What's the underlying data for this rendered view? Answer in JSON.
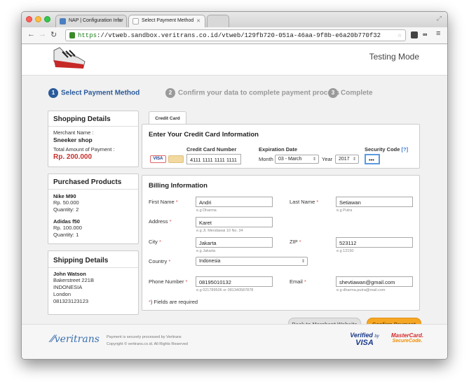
{
  "browser": {
    "tabs": [
      {
        "label": "NAP | Configuration Infor"
      },
      {
        "label": "Select Payment Method"
      }
    ],
    "url_scheme": "https",
    "url_rest": "://vtweb.sandbox.veritrans.co.id/vtweb/129fb720-051a-46aa-9f8b-e6a20b770f32"
  },
  "header": {
    "mode": "Testing Mode"
  },
  "steps": [
    {
      "num": "1",
      "label": "Select Payment Method",
      "active": true
    },
    {
      "num": "2",
      "label": "Confirm your data to complete payment process",
      "active": false
    },
    {
      "num": "3",
      "label": "Complete",
      "active": false
    }
  ],
  "shopping": {
    "title": "Shopping Details",
    "merchant_label": "Merchant Name :",
    "merchant": "Sneeker shop",
    "total_label": "Total Amount of Payment :",
    "total": "Rp. 200.000"
  },
  "products": {
    "title": "Purchased Products",
    "items": [
      {
        "name": "Nike M90",
        "price": "Rp. 50.000",
        "qty": "Quantity: 2"
      },
      {
        "name": "Adidas f50",
        "price": "Rp. 100.000",
        "qty": "Quantity: 1"
      }
    ]
  },
  "shipping": {
    "title": "Shipping Details",
    "name": "John Watson",
    "line1": "Bakerstreet 221B",
    "line2": "INDONESIA",
    "line3": "London",
    "phone": "081323123123"
  },
  "card": {
    "tab": "Credit Card",
    "heading": "Enter Your Credit Card Information",
    "number_label": "Credit Card Number",
    "number": "4111 1111 1111 1111",
    "expiry_label": "Expiration Date",
    "month_label": "Month",
    "month": "03 - March",
    "year_label": "Year",
    "year": "2017",
    "cvv_label": "Security Code",
    "cvv_help": "[?]",
    "cvv": "•••",
    "visa": "VISA"
  },
  "billing": {
    "heading": "Billing Information",
    "first_name_label": "First Name",
    "first_name": "Andri",
    "first_name_hint": "e.g Dharma",
    "last_name_label": "Last Name",
    "last_name": "Setiawan",
    "last_name_hint": "e.g Putra",
    "address_label": "Address",
    "address": "Karet",
    "address_hint": "e.g Jl. Mendawai 10 No. 34",
    "city_label": "City",
    "city": "Jakarta",
    "city_hint": "e.g Jakarta",
    "zip_label": "ZIP",
    "zip": "523112",
    "zip_hint": "e.g 12150",
    "country_label": "Country",
    "country": "Indonesia",
    "phone_label": "Phone Number",
    "phone": "08195010132",
    "phone_hint": "e.g 021789506 or 081340587878",
    "email_label": "Email",
    "email": "shevtiawan@gmail.com",
    "email_hint": "e.g dharma.putra@mail.com",
    "required_star": "*",
    "required_note": ") Fields are required"
  },
  "actions": {
    "back": "Back to Merchant Website",
    "confirm": "Confirm Payment"
  },
  "footer": {
    "brand": "veritrans",
    "line1": "Payment is securely processed by Veritrans",
    "line2": "Copyright © veritrans.co.id. All Rights Reserved",
    "vbv_top": "Verified",
    "vbv_by": "by",
    "vbv_bottom": "VISA",
    "mc_top": "MasterCard.",
    "mc_bottom": "SecureCode."
  },
  "colors": {
    "step_active": "#2a5a9a",
    "step_inactive": "#999999",
    "confirm_bg": "#f5a623",
    "price_red": "#c9302c",
    "required": "#d9534f"
  }
}
